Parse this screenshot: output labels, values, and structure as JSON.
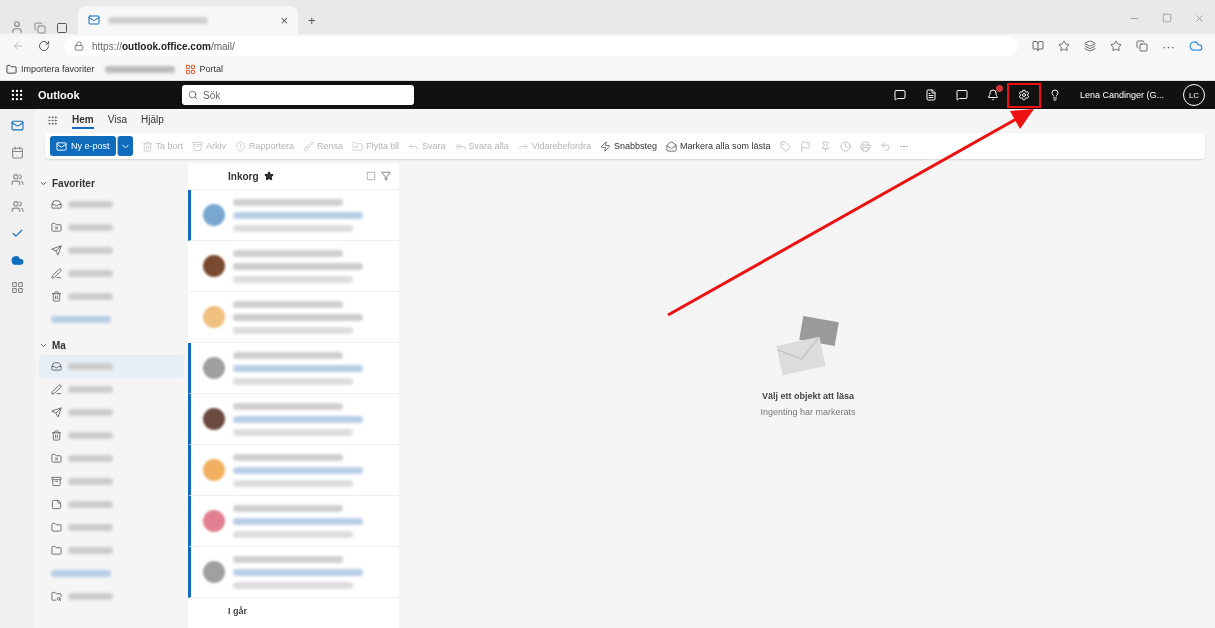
{
  "browser": {
    "url": "https://**outlook.office.com**/mail/",
    "tab_close": "×",
    "new_tab": "+",
    "favorites": [
      {
        "kind": "folder",
        "label": "Importera favoriter"
      },
      {
        "kind": "blurred"
      },
      {
        "kind": "grid",
        "label": "Portal"
      }
    ]
  },
  "header": {
    "app_name": "Outlook",
    "search": {
      "placeholder": "Sök"
    },
    "user_name": "Lena Candinger (G...",
    "avatar": "LC",
    "settings_highlighted": true
  },
  "tabs": [
    {
      "label": "Hem",
      "selected": true
    },
    {
      "label": "Visa",
      "selected": false
    },
    {
      "label": "Hjälp",
      "selected": false
    }
  ],
  "ribbon": {
    "new_mail": "Ny e-post",
    "actions": [
      {
        "kind": "trash",
        "label": "Ta bort",
        "disabled": true
      },
      {
        "kind": "archive",
        "label": "Arkiv",
        "disabled": true
      },
      {
        "kind": "report",
        "label": "Rapportera",
        "disabled": true
      },
      {
        "kind": "sweep",
        "label": "Rensa",
        "disabled": true
      },
      {
        "kind": "move",
        "label": "Flytta till",
        "disabled": true
      },
      {
        "kind": "reply",
        "label": "Svara",
        "disabled": true
      },
      {
        "kind": "replyall",
        "label": "Svara alla",
        "disabled": true
      },
      {
        "kind": "forward",
        "label": "Vidarebefordra",
        "disabled": true
      },
      {
        "kind": "bolt",
        "label": "Snabbsteg",
        "disabled": false
      },
      {
        "kind": "read",
        "label": "Markera alla som lästa",
        "disabled": false
      }
    ],
    "more": "···"
  },
  "folders": {
    "sections": [
      {
        "title": "Favoriter",
        "items": [
          {
            "kind": "inbox",
            "selected": false
          },
          {
            "kind": "junk",
            "selected": false
          },
          {
            "kind": "sent",
            "selected": false
          },
          {
            "kind": "draft",
            "selected": false
          },
          {
            "kind": "trash",
            "selected": false
          },
          {
            "kind": "link",
            "selected": false
          }
        ]
      },
      {
        "title": "Ma",
        "items": [
          {
            "kind": "inbox",
            "selected": true
          },
          {
            "kind": "draft",
            "selected": false
          },
          {
            "kind": "sent",
            "selected": false
          },
          {
            "kind": "trash",
            "selected": false
          },
          {
            "kind": "junk",
            "selected": false
          },
          {
            "kind": "archive",
            "selected": false
          },
          {
            "kind": "note",
            "selected": false
          },
          {
            "kind": "folder",
            "selected": false
          },
          {
            "kind": "folder",
            "selected": false
          },
          {
            "kind": "link",
            "selected": false
          },
          {
            "kind": "search",
            "selected": false
          }
        ]
      }
    ]
  },
  "message_list": {
    "title": "Inkorg",
    "messages": [
      {
        "unread": true,
        "color": "#7aa7cf"
      },
      {
        "unread": false,
        "color": "#7a4a30"
      },
      {
        "unread": false,
        "color": "#f0c080"
      },
      {
        "unread": true,
        "color": "#a0a0a0"
      },
      {
        "unread": true,
        "color": "#6a4a40"
      },
      {
        "unread": true,
        "color": "#f0b060"
      },
      {
        "unread": true,
        "color": "#e08090"
      },
      {
        "unread": true,
        "color": "#a0a0a0"
      }
    ],
    "group_header": "I går"
  },
  "reading_pane": {
    "title": "Välj ett objekt att läsa",
    "subtitle": "Ingenting har markerats"
  }
}
